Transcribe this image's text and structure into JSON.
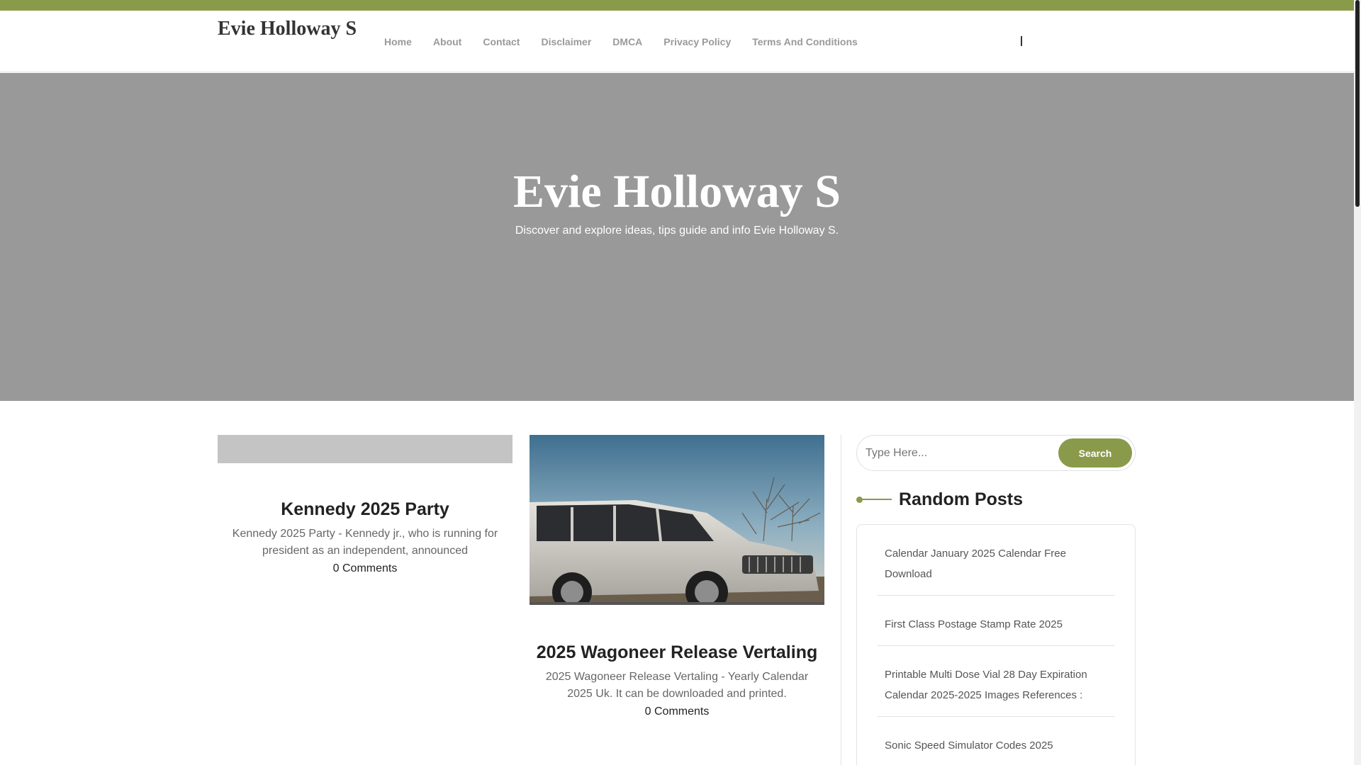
{
  "site": {
    "title": "Evie Holloway S"
  },
  "nav": {
    "items": [
      "Home",
      "About",
      "Contact",
      "Disclaimer",
      "DMCA",
      "Privacy Policy",
      "Terms And Conditions"
    ]
  },
  "hero": {
    "title": "Evie Holloway S",
    "subtitle": "Discover and explore ideas, tips guide and info Evie Holloway S."
  },
  "posts": [
    {
      "title": "Kennedy 2025 Party",
      "excerpt": "Kennedy 2025 Party - Kennedy jr., who is running for president as an independent, announced",
      "comments": "0 Comments"
    },
    {
      "title": "2025 Wagoneer Release Vertaling",
      "excerpt": "2025 Wagoneer Release Vertaling - Yearly Calendar 2025 Uk. It can be downloaded and printed.",
      "comments": "0 Comments"
    }
  ],
  "sidebar": {
    "search": {
      "placeholder": "Type Here...",
      "button_label": "Search"
    },
    "random_posts": {
      "title": "Random Posts",
      "items": [
        "Calendar January 2025 Calendar Free Download",
        "First Class Postage Stamp Rate 2025",
        "Printable Multi Dose Vial 28 Day Expiration Calendar 2025-2025 Images References :",
        "Sonic Speed Simulator Codes 2025"
      ]
    }
  },
  "colors": {
    "accent": "#8a9a4b",
    "hero_bg": "#999999"
  }
}
